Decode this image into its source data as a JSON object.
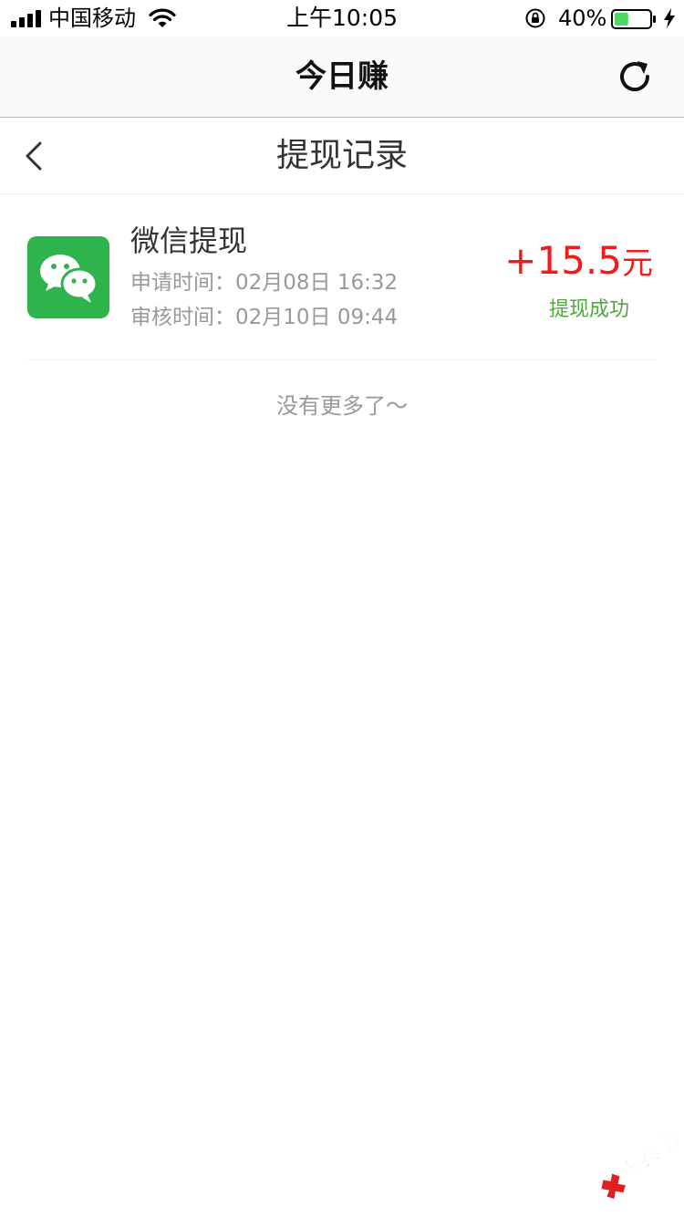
{
  "status_bar": {
    "carrier": "中国移动",
    "time": "上午10:05",
    "battery_percent": "40%",
    "battery_level": 0.4,
    "icons": [
      "signal-icon",
      "wifi-icon",
      "orientation-lock-icon",
      "battery-icon",
      "charging-bolt-icon"
    ]
  },
  "nav": {
    "title": "今日赚",
    "refresh_icon": "refresh-icon"
  },
  "page": {
    "title": "提现记录",
    "back_icon": "chevron-left-icon"
  },
  "records": [
    {
      "icon": "wechat-icon",
      "title": "微信提现",
      "apply_label": "申请时间：",
      "apply_time": "02月08日 16:32",
      "review_label": "审核时间：",
      "review_time": "02月10日 09:44",
      "amount": "+15.5",
      "unit": "元",
      "status": "提现成功"
    }
  ],
  "footer_text": "没有更多了～",
  "watermark": {
    "text": "卡农社区",
    "colors": {
      "accent": "#e02020"
    }
  },
  "colors": {
    "amount": "#f01b1b",
    "status_success": "#4cab3a",
    "wechat_green": "#2fb44d",
    "muted_text": "#999999"
  }
}
